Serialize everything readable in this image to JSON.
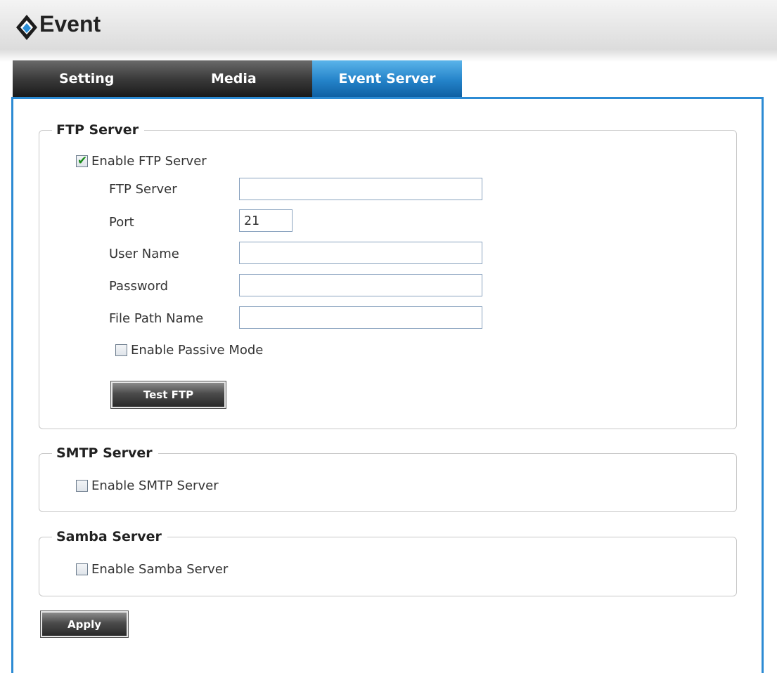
{
  "header": {
    "title": "Event",
    "icon": "diamond-logo-icon"
  },
  "tabs": [
    {
      "label": "Setting",
      "active": false
    },
    {
      "label": "Media",
      "active": false
    },
    {
      "label": "Event Server",
      "active": true
    }
  ],
  "ftp": {
    "legend": "FTP Server",
    "enable_label": "Enable FTP Server",
    "enable_checked": true,
    "fields": {
      "server_label": "FTP Server",
      "server_value": "",
      "port_label": "Port",
      "port_value": "21",
      "user_label": "User Name",
      "user_value": "",
      "password_label": "Password",
      "password_value": "",
      "path_label": "File Path Name",
      "path_value": ""
    },
    "passive_label": "Enable Passive Mode",
    "passive_checked": false,
    "test_button": "Test FTP"
  },
  "smtp": {
    "legend": "SMTP Server",
    "enable_label": "Enable SMTP Server",
    "enable_checked": false
  },
  "samba": {
    "legend": "Samba Server",
    "enable_label": "Enable Samba Server",
    "enable_checked": false
  },
  "apply_button": "Apply",
  "colors": {
    "accent": "#2c8bd4",
    "check": "#1a8a1a",
    "tab_dark": "#2b2b2b"
  }
}
